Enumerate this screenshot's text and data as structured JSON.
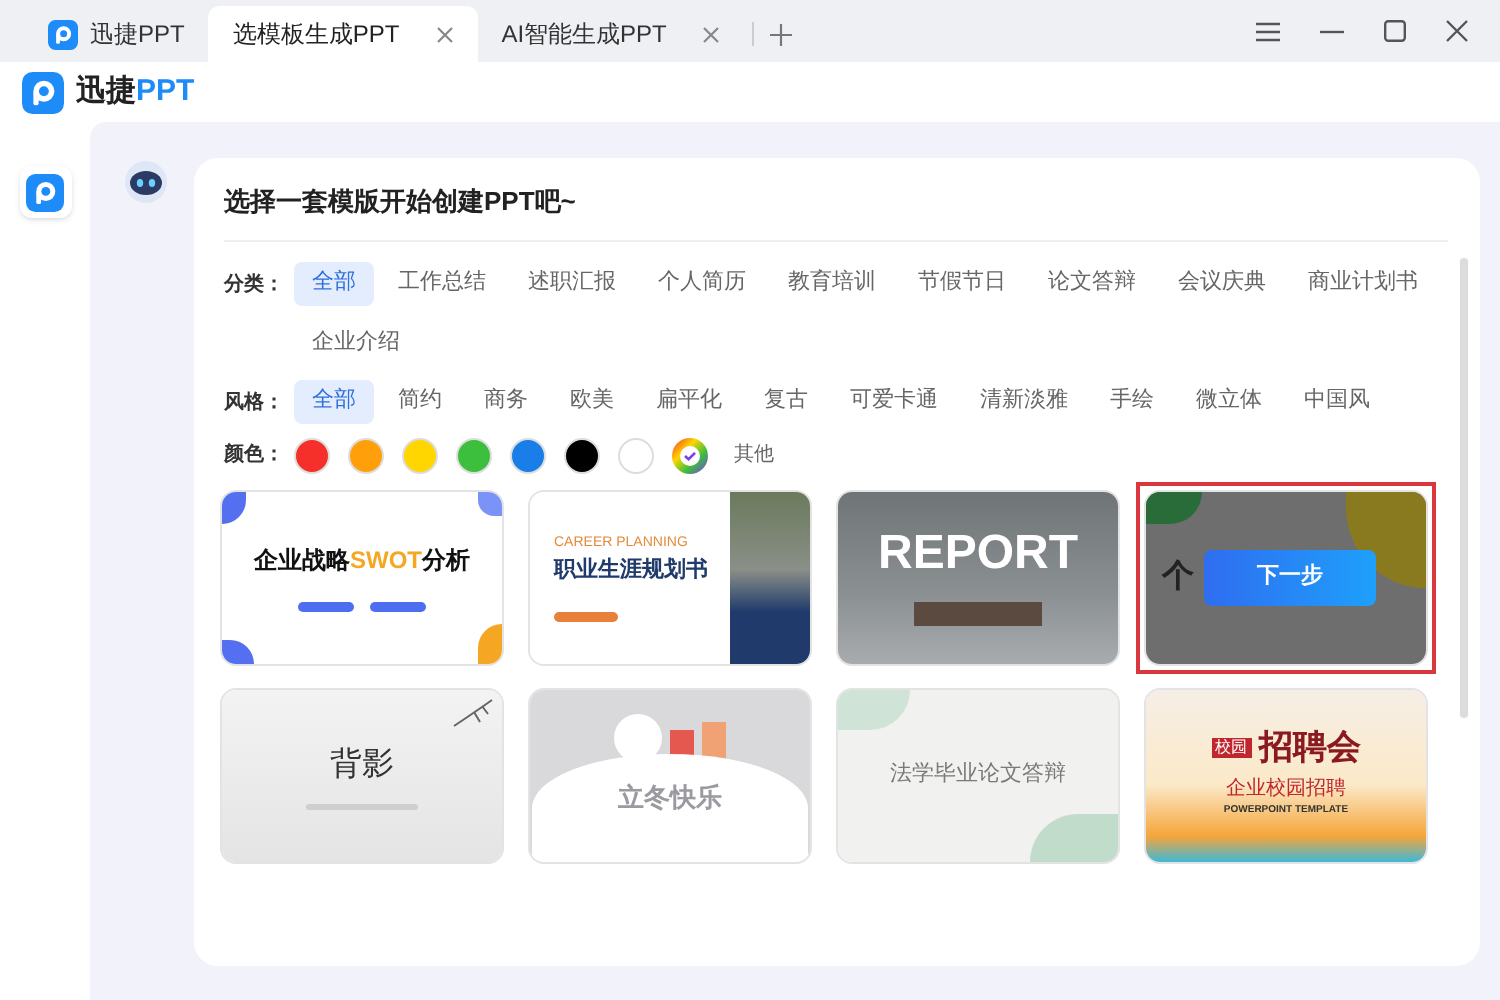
{
  "tabs": [
    {
      "label": "迅捷PPT",
      "kind": "home",
      "selected": false,
      "closable": false
    },
    {
      "label": "选模板生成PPT",
      "kind": "page",
      "selected": true,
      "closable": true
    },
    {
      "label": "AI智能生成PPT",
      "kind": "page",
      "selected": false,
      "closable": true
    }
  ],
  "header": {
    "brand": "迅捷",
    "brand_accent": "PPT"
  },
  "prompt": "选择一套模版开始创建PPT吧~",
  "filters": [
    {
      "label": "分类：",
      "options": [
        {
          "label": "全部",
          "selected": true
        },
        {
          "label": "工作总结",
          "selected": false
        },
        {
          "label": "述职汇报",
          "selected": false
        },
        {
          "label": "个人简历",
          "selected": false
        },
        {
          "label": "教育培训",
          "selected": false
        },
        {
          "label": "节假节日",
          "selected": false
        },
        {
          "label": "论文答辩",
          "selected": false
        },
        {
          "label": "会议庆典",
          "selected": false
        },
        {
          "label": "商业计划书",
          "selected": false
        },
        {
          "label": "企业介绍",
          "selected": false
        }
      ]
    },
    {
      "label": "风格：",
      "options": [
        {
          "label": "全部",
          "selected": true
        },
        {
          "label": "简约",
          "selected": false
        },
        {
          "label": "商务",
          "selected": false
        },
        {
          "label": "欧美",
          "selected": false
        },
        {
          "label": "扁平化",
          "selected": false
        },
        {
          "label": "复古",
          "selected": false
        },
        {
          "label": "可爱卡通",
          "selected": false
        },
        {
          "label": "清新淡雅",
          "selected": false
        },
        {
          "label": "手绘",
          "selected": false
        },
        {
          "label": "微立体",
          "selected": false
        },
        {
          "label": "中国风",
          "selected": false
        }
      ]
    }
  ],
  "colors": {
    "label": "颜色：",
    "swatches": [
      {
        "kind": "solid",
        "color": "#f5302a"
      },
      {
        "kind": "solid",
        "color": "#ff9f0a"
      },
      {
        "kind": "solid",
        "color": "#ffd600"
      },
      {
        "kind": "solid",
        "color": "#3cbf3c"
      },
      {
        "kind": "solid",
        "color": "#1a7ee8"
      },
      {
        "kind": "solid",
        "color": "#000000"
      },
      {
        "kind": "solid",
        "color": "#ffffff"
      },
      {
        "kind": "custom"
      }
    ],
    "more": "其他"
  },
  "templates": [
    {
      "kind": "swot",
      "selected": false,
      "title": "企业战略",
      "accent": "SWOT",
      "title_end": "分析"
    },
    {
      "kind": "career",
      "selected": false,
      "subtitle": "CAREER PLANNING",
      "title": "职业生涯规划书"
    },
    {
      "kind": "report",
      "selected": false,
      "title": "REPORT"
    },
    {
      "kind": "abstract",
      "selected": true,
      "title": "个",
      "action": "下一步"
    },
    {
      "kind": "ink",
      "selected": false,
      "title": "背影"
    },
    {
      "kind": "winter",
      "selected": false,
      "title": "立冬快乐"
    },
    {
      "kind": "leaf",
      "selected": false,
      "title": "法学毕业论文答辩"
    },
    {
      "kind": "recruit",
      "selected": false,
      "badge": "校园",
      "title": "招聘会",
      "subtitle": "企业校园招聘",
      "caption": "POWERPOINT TEMPLATE"
    }
  ]
}
